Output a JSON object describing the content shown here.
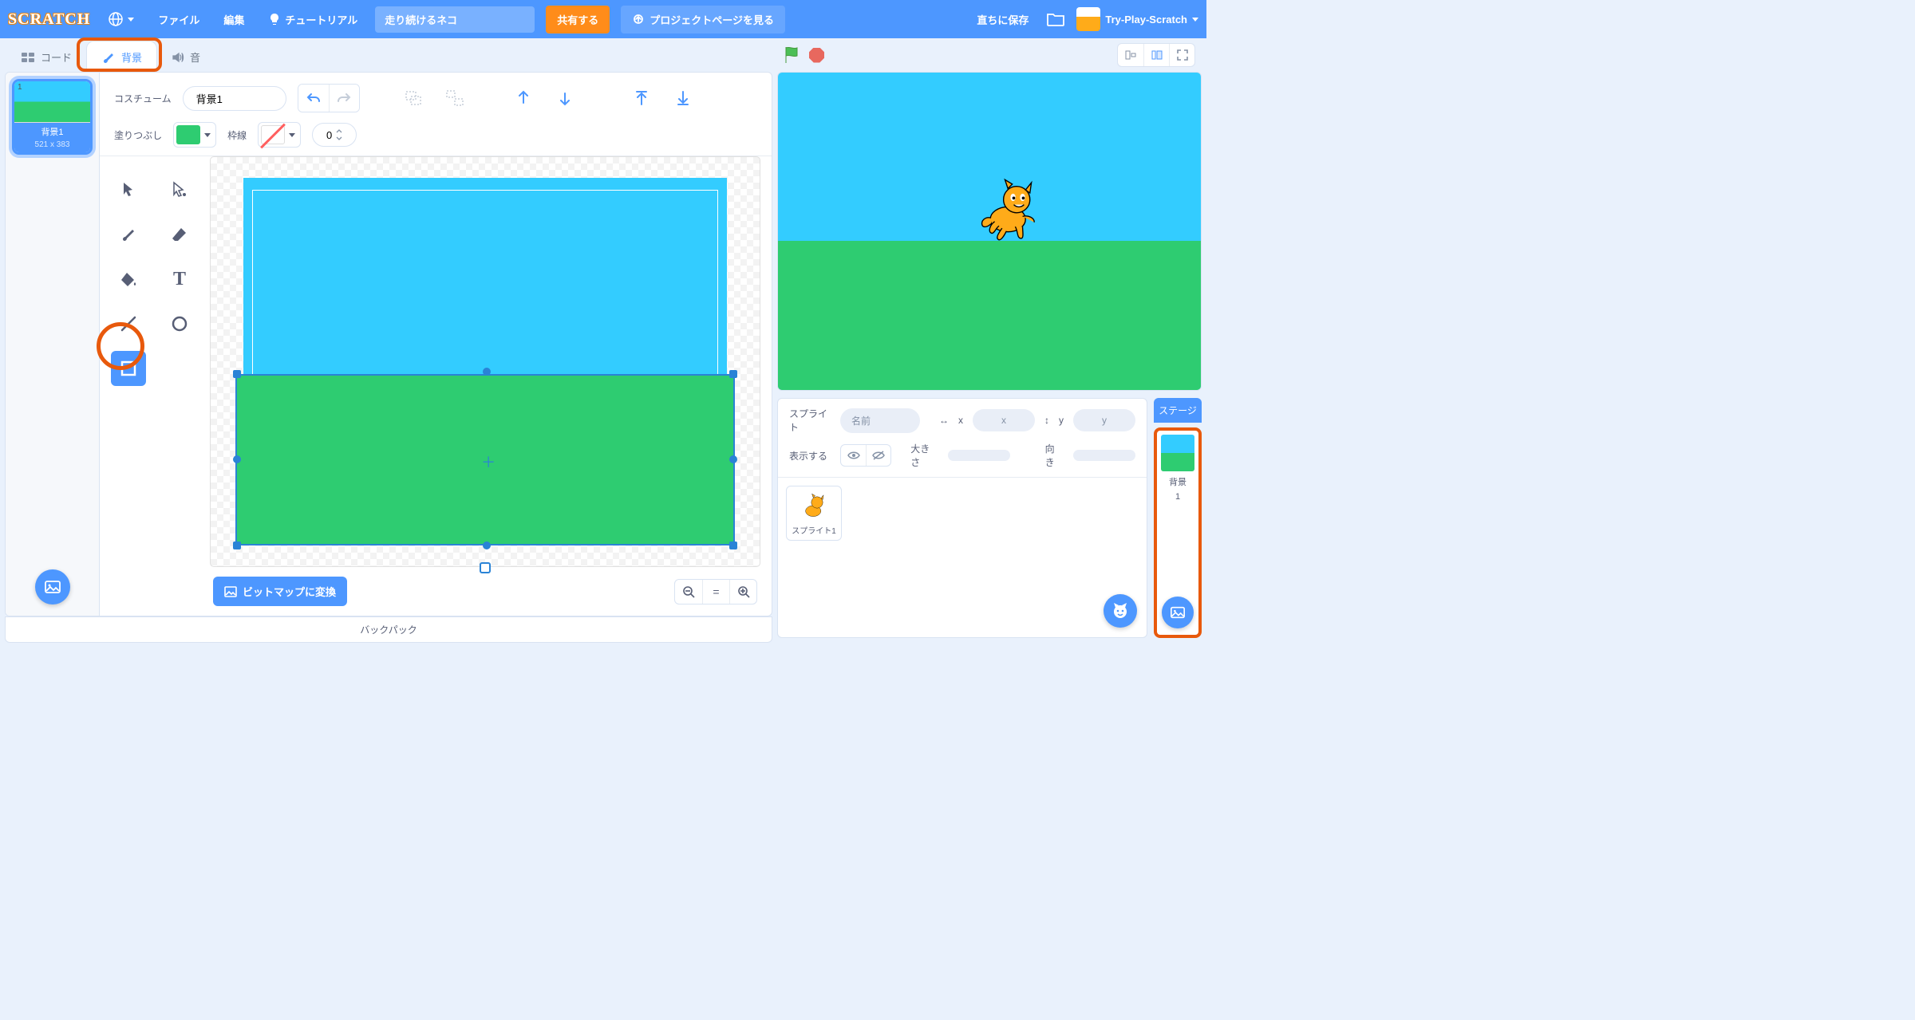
{
  "topbar": {
    "file": "ファイル",
    "edit": "編集",
    "tutorials": "チュートリアル",
    "project_title": "走り続けるネコ",
    "share": "共有する",
    "project_page": "プロジェクトページを見る",
    "save_now": "直ちに保存",
    "username": "Try-Play-Scratch"
  },
  "tabs": {
    "code": "コード",
    "backdrops": "背景",
    "sounds": "音"
  },
  "costume_list": {
    "item1_number": "1",
    "item1_name": "背景1",
    "item1_dims": "521 x 383"
  },
  "paint": {
    "costume_label": "コスチューム",
    "costume_name": "背景1",
    "fill_label": "塗りつぶし",
    "outline_label": "枠線",
    "outline_width": "0",
    "fill_color": "#2ecc71",
    "bitmap_btn": "ビットマップに変換"
  },
  "sprite_panel": {
    "sprite_label": "スプライト",
    "name_placeholder": "名前",
    "x_label": "x",
    "x_val": "x",
    "y_label": "y",
    "y_val": "y",
    "show_label": "表示する",
    "size_label": "大きさ",
    "direction_label": "向き",
    "sprite1_name": "スプライト1"
  },
  "stage_col": {
    "header": "ステージ",
    "backdrop_label": "背景",
    "backdrop_count": "1"
  },
  "backpack": "バックパック"
}
